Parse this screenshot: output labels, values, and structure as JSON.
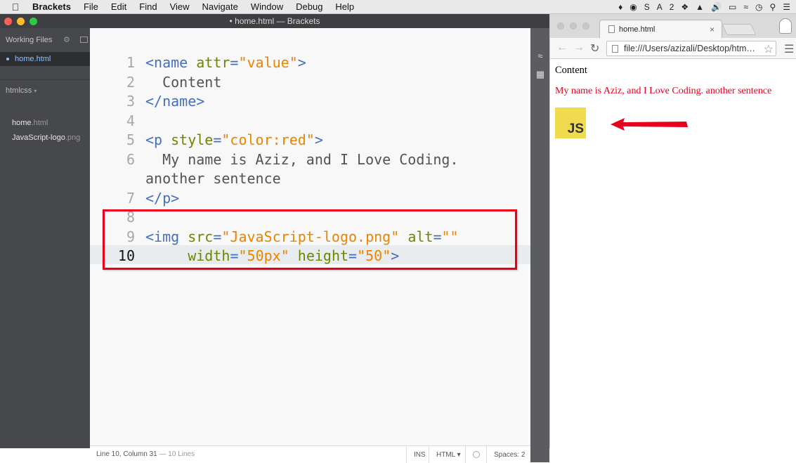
{
  "menubar": {
    "app": "Brackets",
    "items": [
      "File",
      "Edit",
      "Find",
      "View",
      "Navigate",
      "Window",
      "Debug",
      "Help"
    ],
    "status_badge": "2"
  },
  "window": {
    "title": "• home.html — Brackets"
  },
  "sidebar": {
    "working_files_label": "Working Files",
    "active_file": "home.html",
    "project_label": "htmlcss",
    "files": [
      {
        "name": "home",
        "ext": ".html"
      },
      {
        "name": "JavaScript-logo",
        "ext": ".png"
      }
    ]
  },
  "editor": {
    "lines": [
      {
        "num": "1",
        "segs": [
          [
            "tag",
            "<name "
          ],
          [
            "attr",
            "attr"
          ],
          [
            "tag",
            "="
          ],
          [
            "val",
            "\"value\""
          ],
          [
            "tag",
            ">"
          ]
        ]
      },
      {
        "num": "2",
        "segs": [
          [
            "txt",
            "  Content"
          ]
        ]
      },
      {
        "num": "3",
        "segs": [
          [
            "tag",
            "</name>"
          ]
        ]
      },
      {
        "num": "4",
        "segs": []
      },
      {
        "num": "5",
        "segs": [
          [
            "tag",
            "<p "
          ],
          [
            "attr",
            "style"
          ],
          [
            "tag",
            "="
          ],
          [
            "val",
            "\"color:red\""
          ],
          [
            "tag",
            ">"
          ]
        ]
      },
      {
        "num": "6",
        "segs": [
          [
            "txt",
            "  My name is Aziz, and I Love Coding."
          ]
        ]
      },
      {
        "num": "",
        "segs": [
          [
            "txt",
            "another sentence"
          ]
        ]
      },
      {
        "num": "7",
        "segs": [
          [
            "tag",
            "</p>"
          ]
        ]
      },
      {
        "num": "8",
        "segs": []
      },
      {
        "num": "9",
        "segs": [
          [
            "tag",
            "<img "
          ],
          [
            "attr",
            "src"
          ],
          [
            "tag",
            "="
          ],
          [
            "val",
            "\"JavaScript-logo.png\""
          ],
          [
            "tag",
            " "
          ],
          [
            "attr",
            "alt"
          ],
          [
            "tag",
            "="
          ],
          [
            "val",
            "\"\""
          ]
        ]
      },
      {
        "num": "10",
        "segs": [
          [
            "tag",
            "     "
          ],
          [
            "attr",
            "width"
          ],
          [
            "tag",
            "="
          ],
          [
            "val",
            "\"50px\""
          ],
          [
            "tag",
            " "
          ],
          [
            "attr",
            "height"
          ],
          [
            "tag",
            "="
          ],
          [
            "val",
            "\"50\""
          ],
          [
            "tag",
            ">"
          ]
        ],
        "current": true
      }
    ]
  },
  "statusbar": {
    "position": "Line 10, Column 31",
    "line_count": " — 10 Lines",
    "mode": "INS",
    "language": "HTML ▾",
    "spaces": "Spaces:  2"
  },
  "browser": {
    "tab_title": "home.html",
    "url": "file:///Users/azizali/Desktop/htm…",
    "content_text": "Content",
    "red_text": "My name is Aziz, and I Love Coding. another sentence",
    "logo_text": "JS"
  },
  "colors": {
    "tag": "#446fbd",
    "attribute": "#6d8600",
    "value": "#e88501",
    "highlight": "#e8001c",
    "red_paragraph": "#e6001e"
  }
}
